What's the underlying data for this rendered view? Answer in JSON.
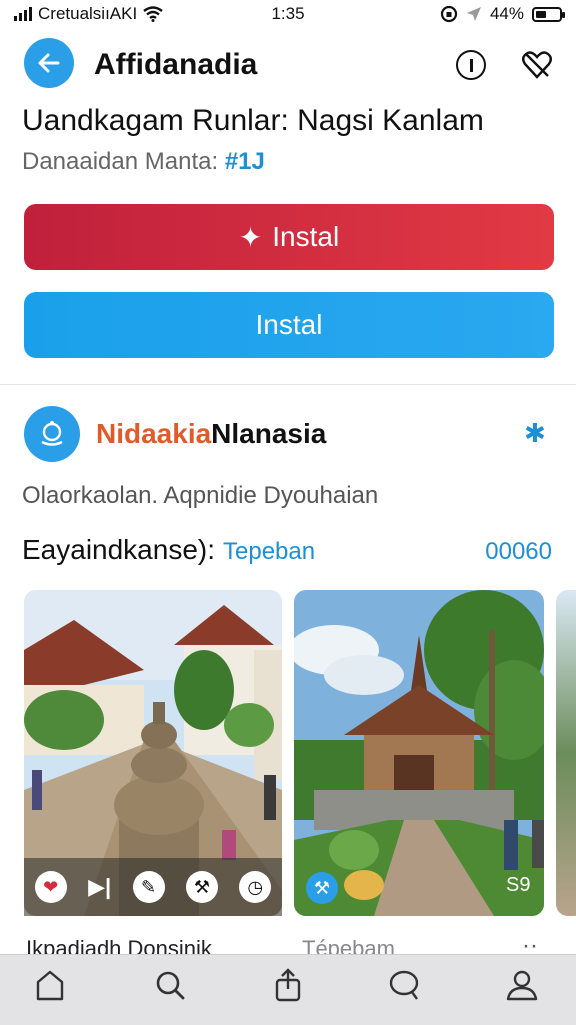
{
  "status": {
    "carrier": "CretualsiıAKI",
    "time": "1:35",
    "battery": "44%",
    "battery_level": 0.44
  },
  "appbar": {
    "title": "Affidanadia"
  },
  "app": {
    "heading": "Uandkagam Runlar: Nagsi Kanlam",
    "subheading": "Danaaidan Manta:",
    "subheading_tag": "#1J"
  },
  "buttons": {
    "install_primary": "Instal",
    "install_secondary": "Instal"
  },
  "developer": {
    "name_part1": "Nidaakia",
    "name_part2": "Nlanasia",
    "star": "✱"
  },
  "description": "Olaorkaolan.  Aqpnidie Dyouhaian",
  "meta": {
    "label": "Eayaindkanse):",
    "tag": "Tepeban",
    "count": "00060"
  },
  "screenshots": {
    "shot1_caption": "Ikpadiadh Donsinik",
    "shot2_caption": "Tépebam",
    "shot2_label": "S9",
    "more": "··"
  },
  "colors": {
    "accent": "#2a9fe8",
    "install_red": "#d2283c",
    "install_blue": "#1ea4ed"
  },
  "tabs": [
    "home-icon",
    "search-icon",
    "share-icon",
    "chat-icon",
    "profile-icon"
  ]
}
